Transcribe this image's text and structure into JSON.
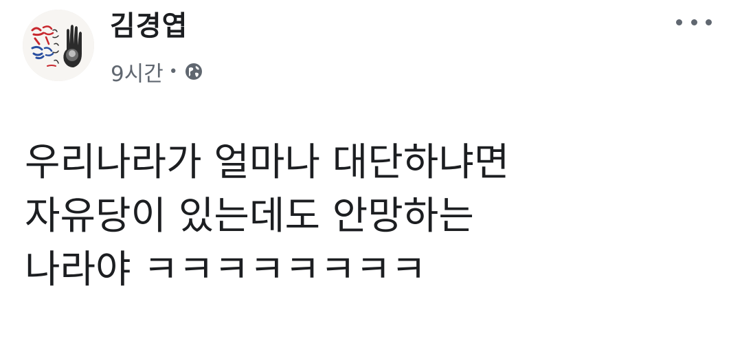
{
  "post": {
    "author": "김경엽",
    "time": "9시간",
    "separator": "•",
    "privacy_icon": "globe-icon",
    "more_icon": "more-options-icon",
    "avatar_icon": "profile-avatar",
    "lines": [
      "우리나라가 얼마나 대단하냐면",
      "자유당이 있는데도 안망하는",
      "나라야 ㅋㅋㅋㅋㅋㅋㅋㅋ"
    ]
  },
  "colors": {
    "text": "#1c1e21",
    "secondary": "#606770",
    "background": "#ffffff"
  }
}
